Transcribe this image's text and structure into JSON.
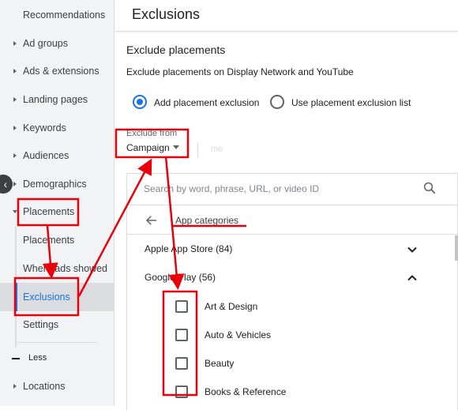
{
  "sidebar": {
    "items": [
      {
        "label": "Recommendations"
      },
      {
        "label": "Ad groups"
      },
      {
        "label": "Ads & extensions"
      },
      {
        "label": "Landing pages"
      },
      {
        "label": "Keywords"
      },
      {
        "label": "Audiences"
      },
      {
        "label": "Demographics"
      },
      {
        "label": "Placements"
      },
      {
        "label": "Placements"
      },
      {
        "label": "Where ads showed"
      },
      {
        "label": "Exclusions"
      },
      {
        "label": "Settings"
      },
      {
        "label": "Locations"
      }
    ],
    "less_label": "Less",
    "collapse_icon": "chevron-left-icon"
  },
  "header": {
    "title": "Exclusions"
  },
  "main": {
    "section_title": "Exclude placements",
    "section_desc": "Exclude placements on Display Network and YouTube",
    "radio_add": "Add placement exclusion",
    "radio_list": "Use placement exclusion list",
    "exclude_from_label": "Exclude from",
    "exclude_from_value": "Campaign",
    "faded_text": "me",
    "search_placeholder": "Search by word, phrase, URL, or video ID",
    "breadcrumb": "App categories",
    "groups": [
      {
        "label": "Apple App Store (84)",
        "expanded": false
      },
      {
        "label": "Google Play (56)",
        "expanded": true
      }
    ],
    "items": [
      {
        "label": "Art & Design",
        "checked": false
      },
      {
        "label": "Auto & Vehicles",
        "checked": false
      },
      {
        "label": "Beauty",
        "checked": false
      },
      {
        "label": "Books & Reference",
        "checked": false
      }
    ]
  },
  "colors": {
    "accent": "#1a73e8",
    "annotation": "#e8000b"
  }
}
